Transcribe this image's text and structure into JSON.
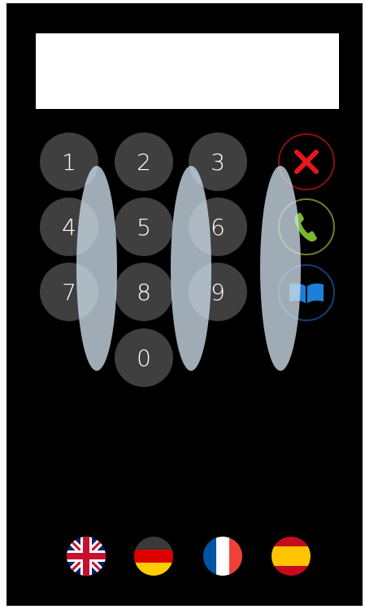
{
  "display": {
    "value": ""
  },
  "keypad": {
    "keys": [
      "1",
      "2",
      "3",
      "4",
      "5",
      "6",
      "7",
      "8",
      "9",
      "0"
    ]
  },
  "actions": {
    "clear": {
      "icon": "close-icon",
      "color": "#e8161b"
    },
    "call": {
      "icon": "phone-icon",
      "color": "#7ab82e"
    },
    "contacts": {
      "icon": "book-icon",
      "color": "#1e7fd8"
    }
  },
  "languages": [
    {
      "code": "en",
      "icon": "uk-flag-icon"
    },
    {
      "code": "de",
      "icon": "germany-flag-icon"
    },
    {
      "code": "fr",
      "icon": "france-flag-icon"
    },
    {
      "code": "es",
      "icon": "spain-flag-icon"
    }
  ],
  "colors": {
    "background": "#000000",
    "key": "#3f3f3f",
    "overlay": "#cddce8"
  }
}
